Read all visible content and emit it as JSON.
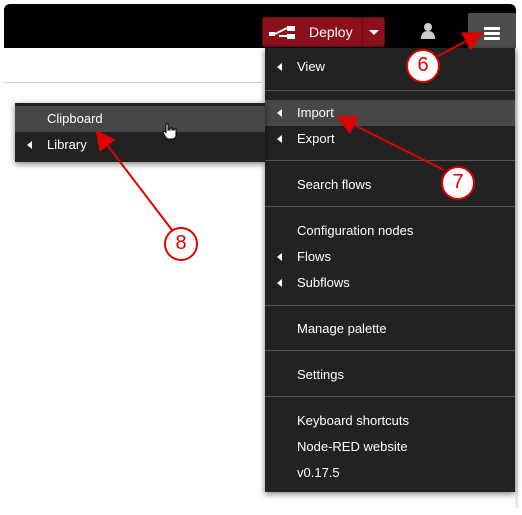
{
  "header": {
    "deploy_label": "Deploy"
  },
  "main_menu": {
    "items": [
      {
        "label": "View",
        "submenu": true
      },
      {
        "label": "Import",
        "submenu": true,
        "active": true
      },
      {
        "label": "Export",
        "submenu": true
      },
      {
        "label": "Search flows",
        "submenu": false
      },
      {
        "label": "Configuration nodes",
        "submenu": false
      },
      {
        "label": "Flows",
        "submenu": true
      },
      {
        "label": "Subflows",
        "submenu": true
      },
      {
        "label": "Manage palette",
        "submenu": false
      },
      {
        "label": "Settings",
        "submenu": false
      },
      {
        "label": "Keyboard shortcuts",
        "submenu": false
      },
      {
        "label": "Node-RED website",
        "submenu": false
      },
      {
        "label": "v0.17.5",
        "submenu": false
      }
    ]
  },
  "import_submenu": {
    "items": [
      {
        "label": "Clipboard",
        "submenu": false,
        "active": true
      },
      {
        "label": "Library",
        "submenu": true
      }
    ]
  },
  "annotations": {
    "callout_6": "6",
    "callout_7": "7",
    "callout_8": "8",
    "color": "#e00000"
  },
  "colors": {
    "header_bg": "#000000",
    "deploy_bg": "#8c101c",
    "menu_bg": "#222222",
    "menu_active_bg": "#474747"
  }
}
